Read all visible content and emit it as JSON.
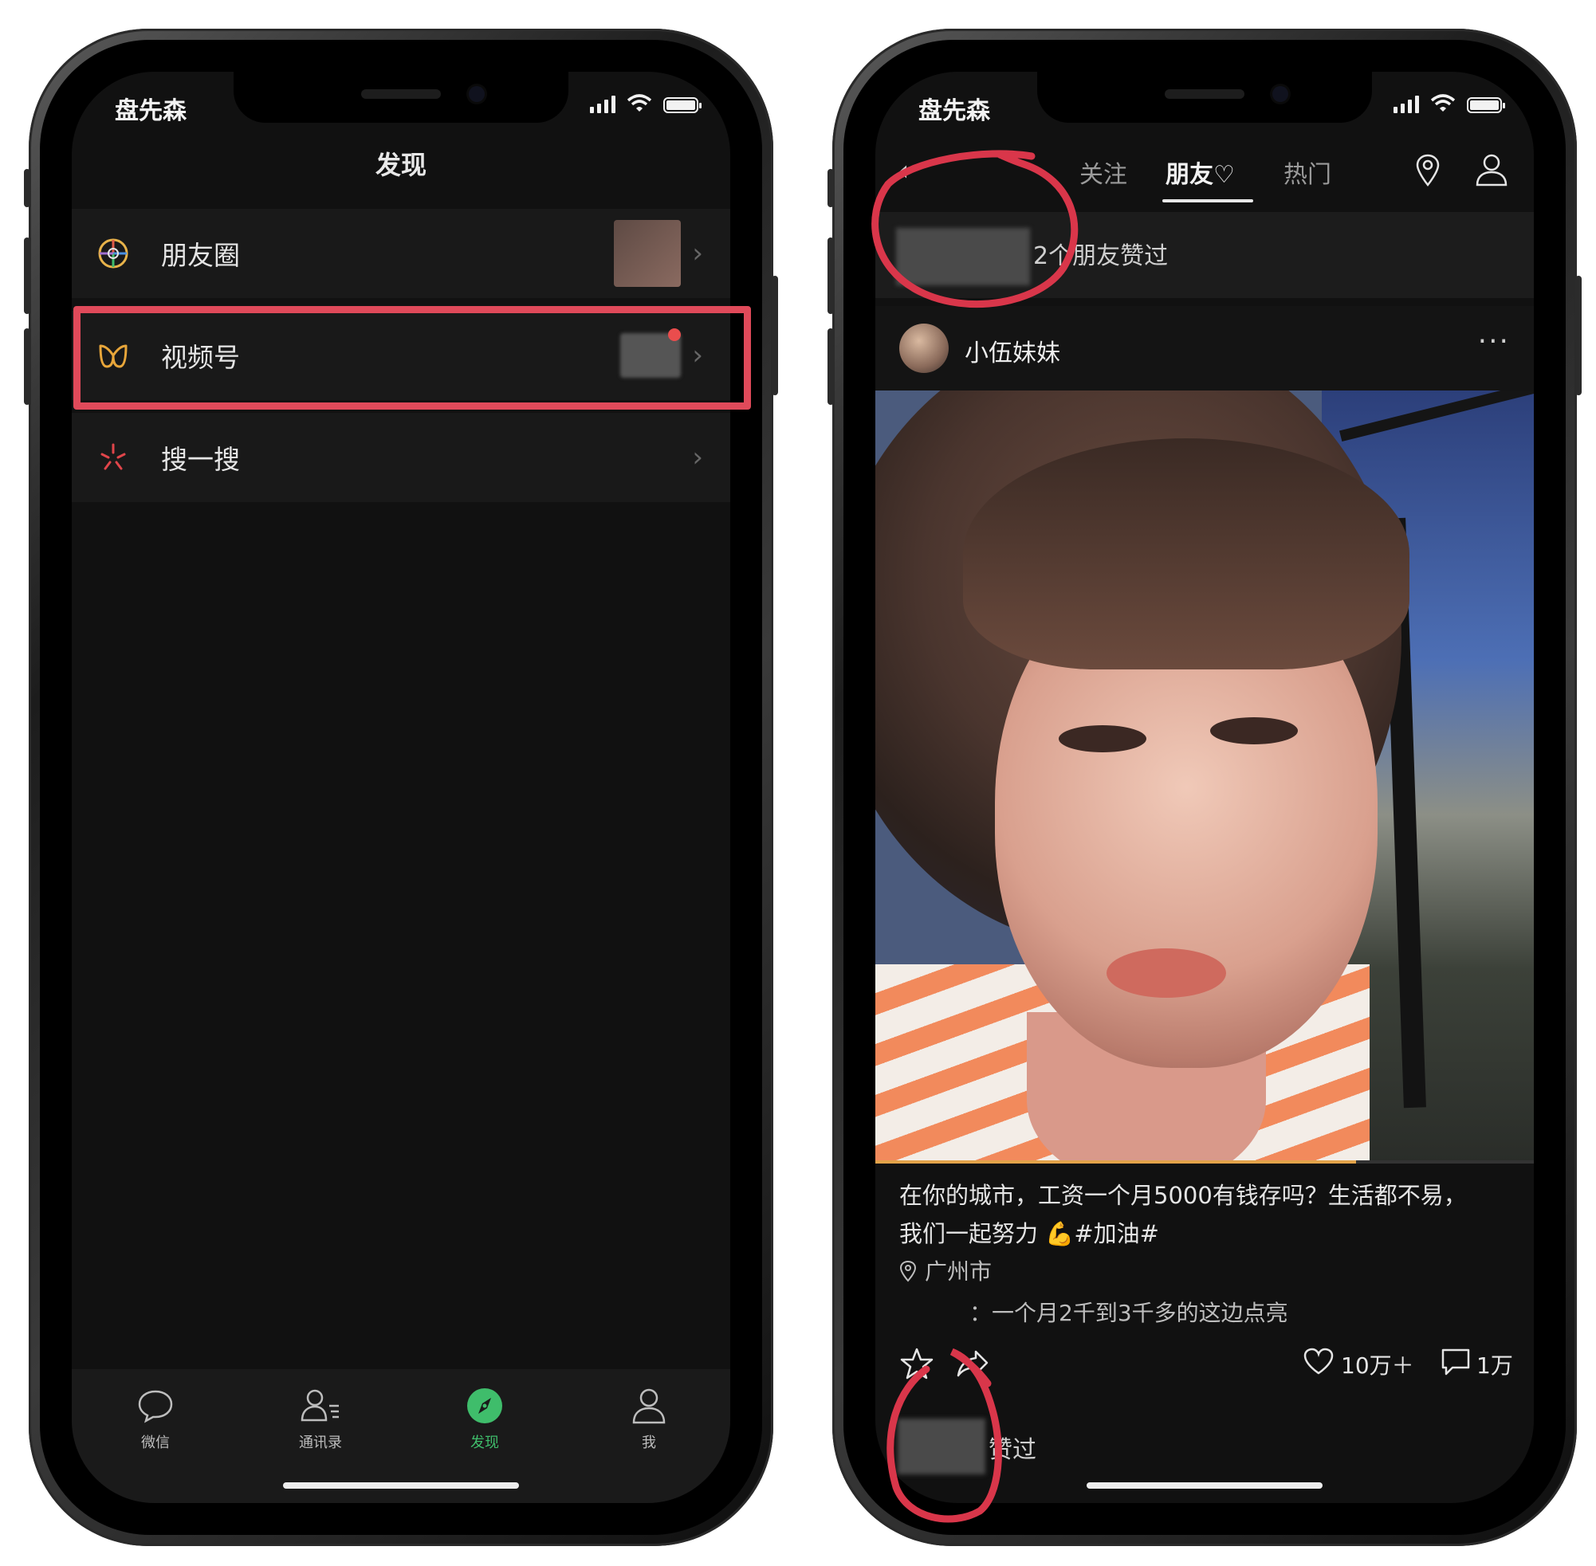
{
  "left_phone": {
    "status": {
      "name": "盘先森"
    },
    "nav_title": "发现",
    "cells": [
      {
        "label": "朋友圈",
        "icon": "moments-icon",
        "chevron": "›"
      },
      {
        "label": "视频号",
        "icon": "channels-icon",
        "chevron": "›"
      },
      {
        "label": "搜一搜",
        "icon": "search-sparkle-icon",
        "chevron": "›"
      }
    ],
    "tabs": [
      {
        "label": "微信",
        "icon": "chat-bubble-icon"
      },
      {
        "label": "通讯录",
        "icon": "contacts-icon"
      },
      {
        "label": "发现",
        "icon": "compass-icon",
        "active": true
      },
      {
        "label": "我",
        "icon": "person-icon"
      }
    ],
    "accent_green": "#3fbd6b",
    "highlight_color": "#e04a5a"
  },
  "right_phone": {
    "status": {
      "name": "盘先森"
    },
    "topnav": {
      "back": "‹",
      "tabs": [
        "关注",
        "朋友♡",
        "热门"
      ],
      "active_tab": "朋友♡",
      "icons": [
        "location-pin-icon",
        "profile-icon"
      ]
    },
    "liked_by_friends": "2个朋友赞过",
    "author": {
      "name": "小伍妹妹",
      "more": "···"
    },
    "video": {
      "progress_fraction": 0.73
    },
    "caption_line1": "在你的城市，工资一个月5000有钱存吗？生活都不易，",
    "caption_line2": "我们一起努力 💪#加油#",
    "location": "广州市",
    "top_comment": "：一个月2千到3千多的这边点亮",
    "stats": {
      "likes": "10万＋",
      "comments": "1万"
    },
    "liked_footer": "赞过",
    "annotation_color": "#d9364a"
  }
}
